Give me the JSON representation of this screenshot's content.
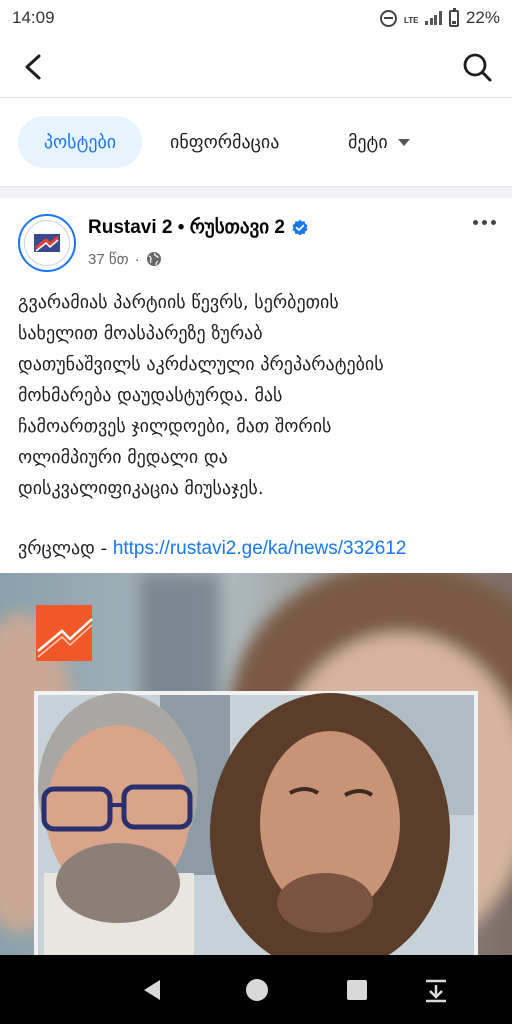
{
  "status_bar": {
    "time": "14:09",
    "network": "LTE",
    "battery": "22%"
  },
  "header": {
    "back_icon": "chevron-left-icon",
    "search_icon": "search-icon"
  },
  "tabs": [
    {
      "label": "პოსტები",
      "active": true
    },
    {
      "label": "ინფორმაცია",
      "active": false
    },
    {
      "label": "მეტი",
      "active": false
    }
  ],
  "post": {
    "page_name": "Rustavi 2 • რუსთავი 2",
    "verified": true,
    "time_ago": "37 წთ",
    "dot": "·",
    "audience_icon": "globe-icon",
    "text_lines": [
      "გვარამიას პარტიის წევრს, სერბეთის",
      "სახელით მოასპარეზე ზურაბ",
      "დათუნაშვილს აკრძალული პრეპარატების",
      "მოხმარება დაუდასტურდა. მას",
      "ჩამოართვეს ჯილდოები, მათ შორის",
      "ოლიმპიური მედალი და",
      "დისკვალიფიკაცია მიუსაჯეს."
    ],
    "link_prefix": "ვრცლად - ",
    "link_url": "https://rustavi2.ge/ka/news/332612"
  },
  "colors": {
    "accent": "#1877f2",
    "tab_active_bg": "#e7f3ff",
    "logo_orange": "#f0582a",
    "nav_bg": "#000000"
  }
}
